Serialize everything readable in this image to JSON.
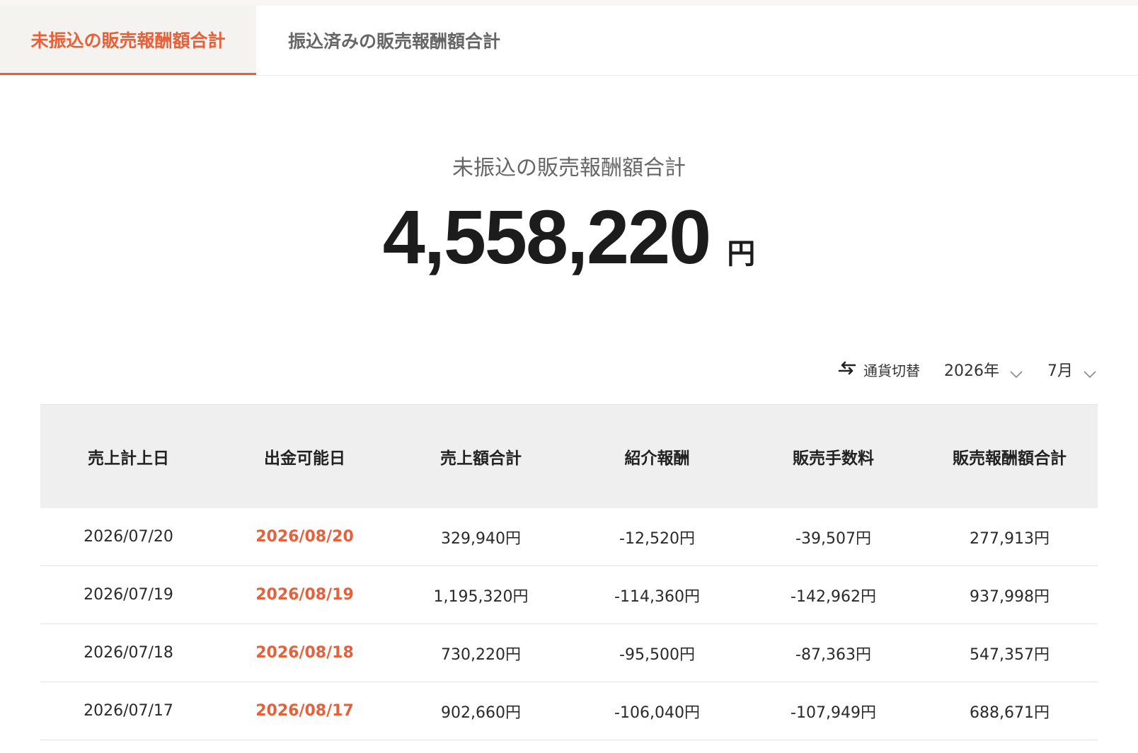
{
  "tabs": [
    {
      "label": "未振込の販売報酬額合計",
      "active": true
    },
    {
      "label": "振込済みの販売報酬額合計",
      "active": false
    }
  ],
  "summary": {
    "label": "未振込の販売報酬額合計",
    "amount": "4,558,220",
    "unit": "円"
  },
  "controls": {
    "currency_switch_label": "通貨切替",
    "currency_icon": "swap-arrows-icon",
    "year": "2026年",
    "month": "7月"
  },
  "table": {
    "headers": [
      "売上計上日",
      "出金可能日",
      "売上額合計",
      "紹介報酬",
      "販売手数料",
      "販売報酬額合計"
    ],
    "rows": [
      [
        "2026/07/20",
        "2026/08/20",
        "329,940円",
        "-12,520円",
        "-39,507円",
        "277,913円"
      ],
      [
        "2026/07/19",
        "2026/08/19",
        "1,195,320円",
        "-114,360円",
        "-142,962円",
        "937,998円"
      ],
      [
        "2026/07/18",
        "2026/08/18",
        "730,220円",
        "-95,500円",
        "-87,363円",
        "547,357円"
      ],
      [
        "2026/07/17",
        "2026/08/17",
        "902,660円",
        "-106,040円",
        "-107,949円",
        "688,671円"
      ]
    ]
  },
  "colors": {
    "accent": "#e8603a",
    "header_bg": "#efefef",
    "tab_active_bg": "#f5f3f0"
  }
}
